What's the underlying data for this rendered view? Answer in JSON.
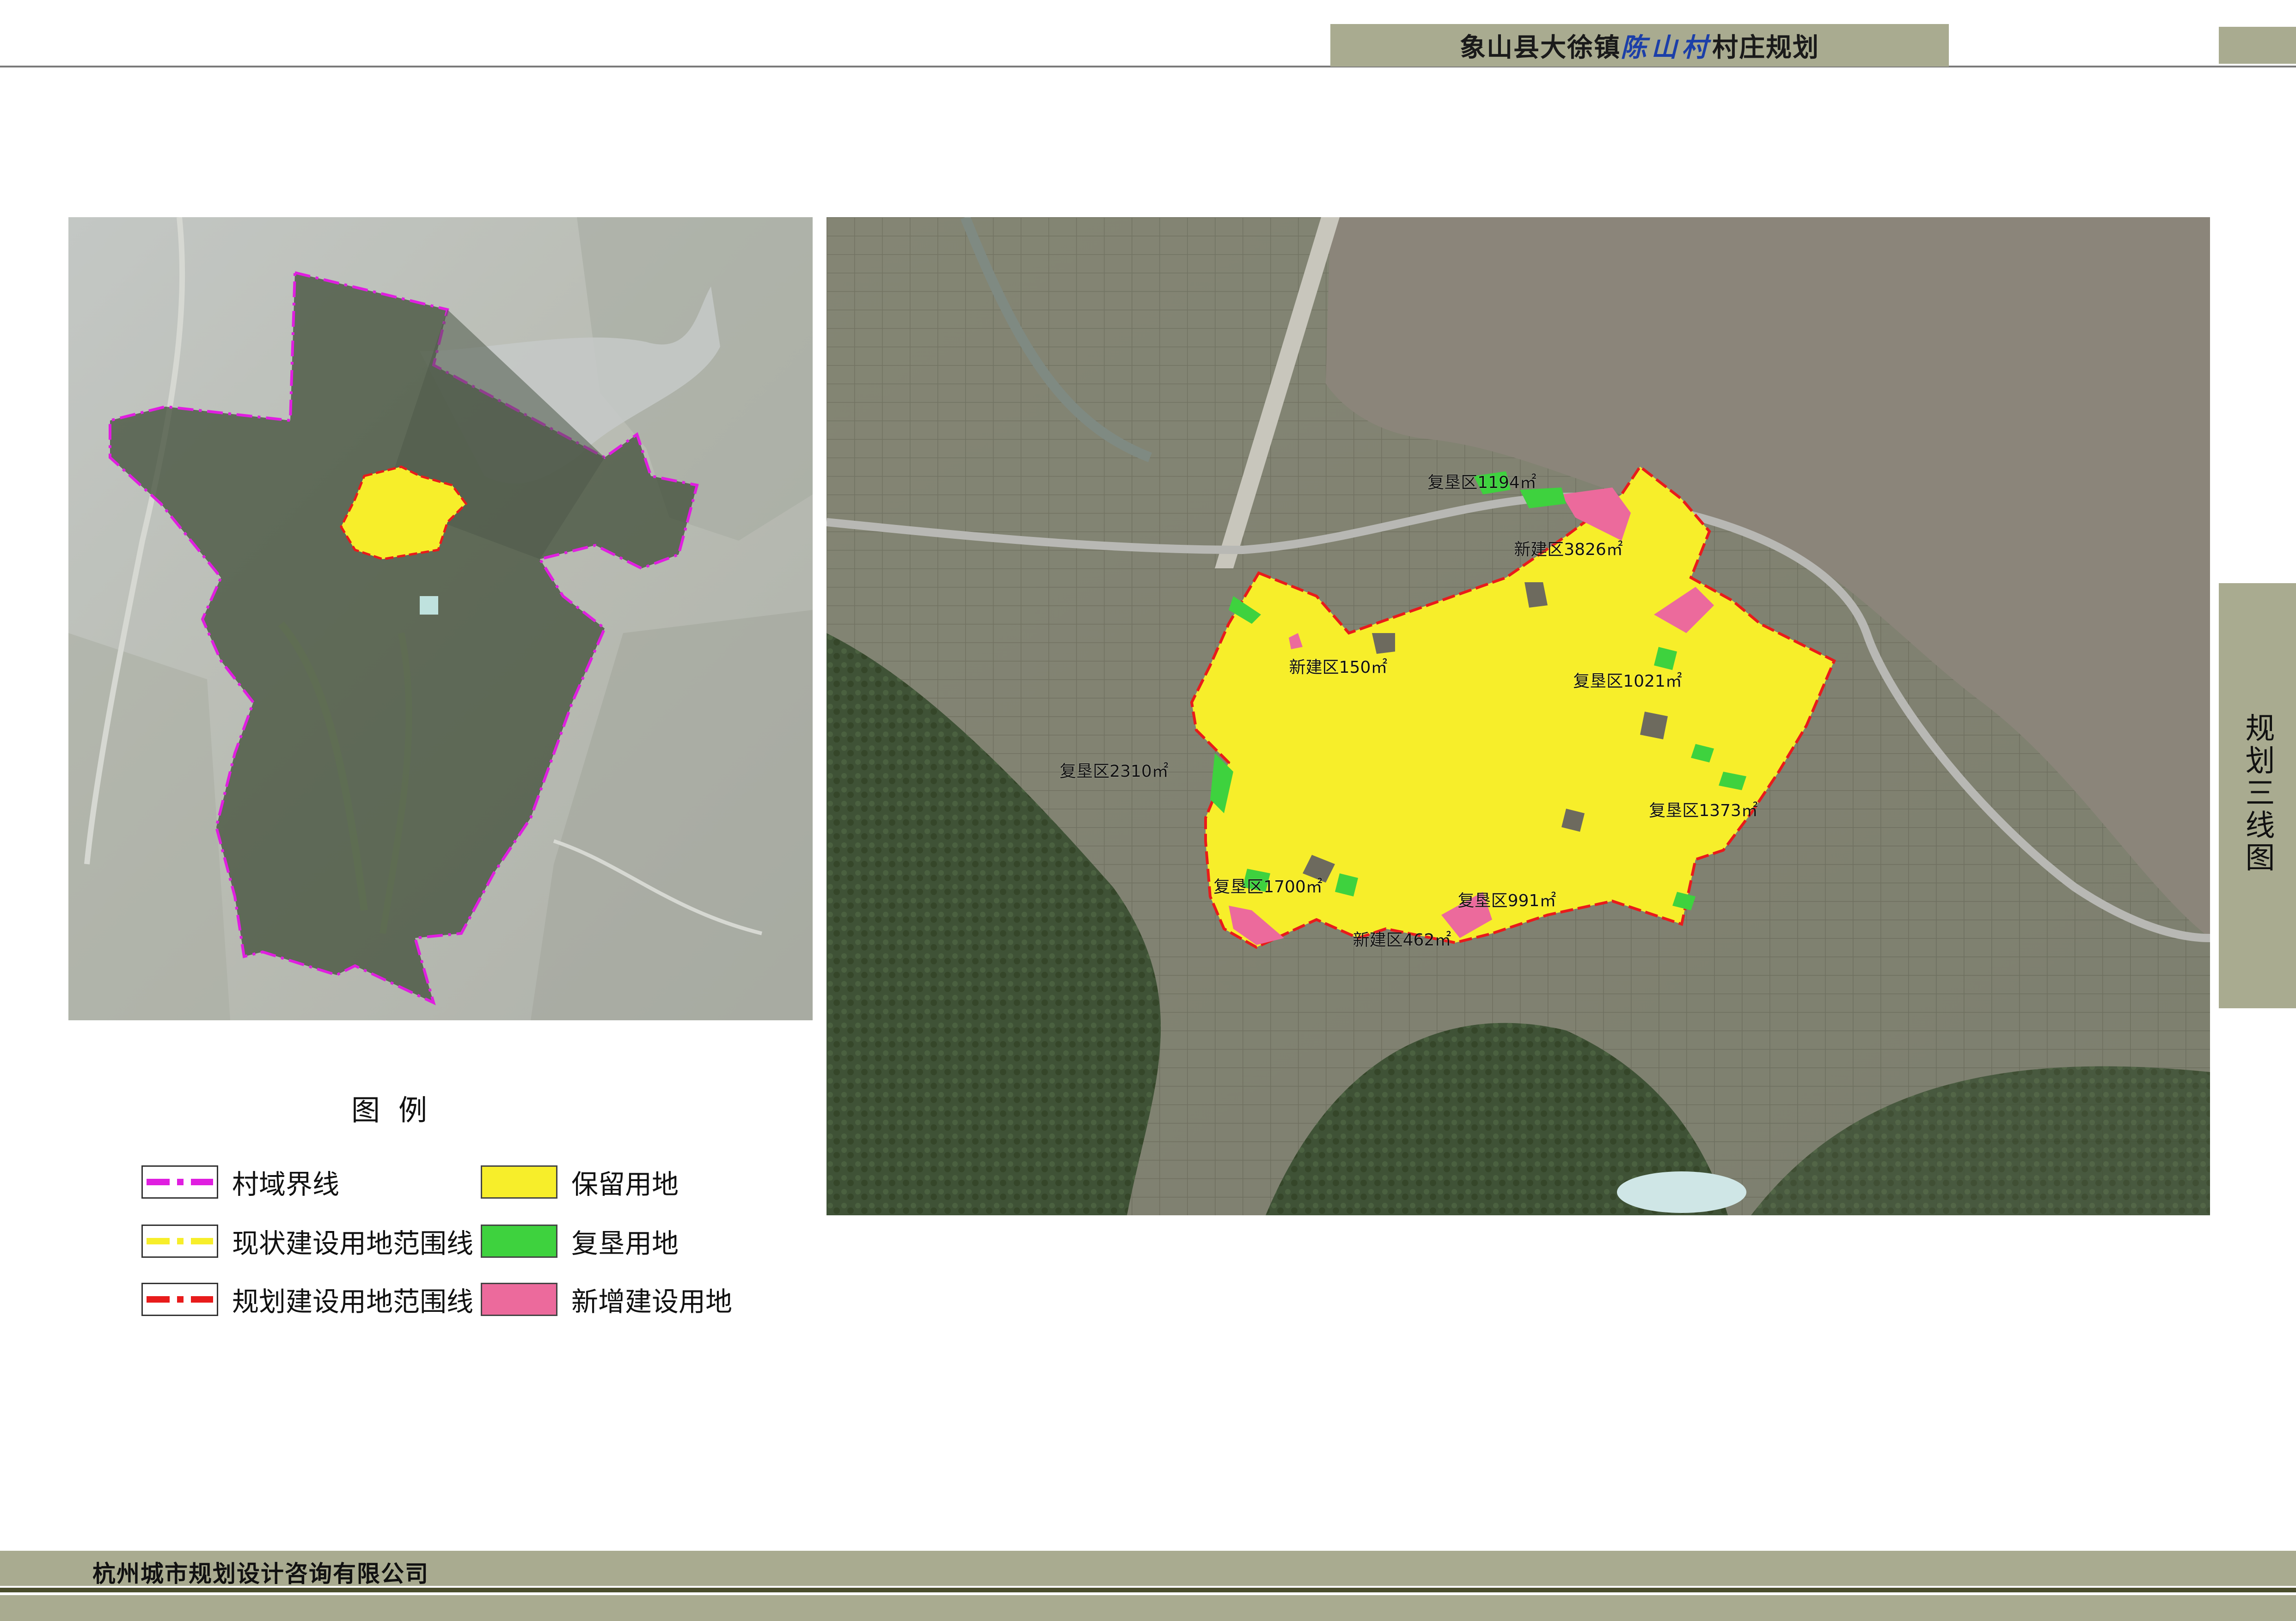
{
  "header": {
    "title_prefix": "象山县大徐镇",
    "title_accent": "陈山村",
    "title_suffix": "村庄规划"
  },
  "side_tab": {
    "label": "规划三线图"
  },
  "overview_map": {
    "imagery": "satellite",
    "boundary_color": "#e01ee0",
    "existing_area_color": "#f7ee2a"
  },
  "detail_map": {
    "imagery": "satellite",
    "labels": [
      "复垦区1194㎡",
      "新建区3826㎡",
      "新建区150㎡",
      "复垦区1021㎡",
      "复垦区2310㎡",
      "复垦区1373㎡",
      "复垦区1700㎡",
      "复垦区991㎡",
      "新建区462㎡"
    ]
  },
  "legend": {
    "title": "图例",
    "items": [
      {
        "label": "村域界线",
        "kind": "line",
        "color": "#e01ee0"
      },
      {
        "label": "现状建设用地范围线",
        "kind": "line",
        "color": "#f7ee2a"
      },
      {
        "label": "规划建设用地范围线",
        "kind": "line",
        "color": "#e81b1b"
      },
      {
        "label": "保留用地",
        "kind": "fill",
        "color": "#f7ee2a"
      },
      {
        "label": "复垦用地",
        "kind": "fill",
        "color": "#3ed23e"
      },
      {
        "label": "新增建设用地",
        "kind": "fill",
        "color": "#ec6a9c"
      }
    ]
  },
  "footer": {
    "company": "杭州城市规划设计咨询有限公司"
  }
}
